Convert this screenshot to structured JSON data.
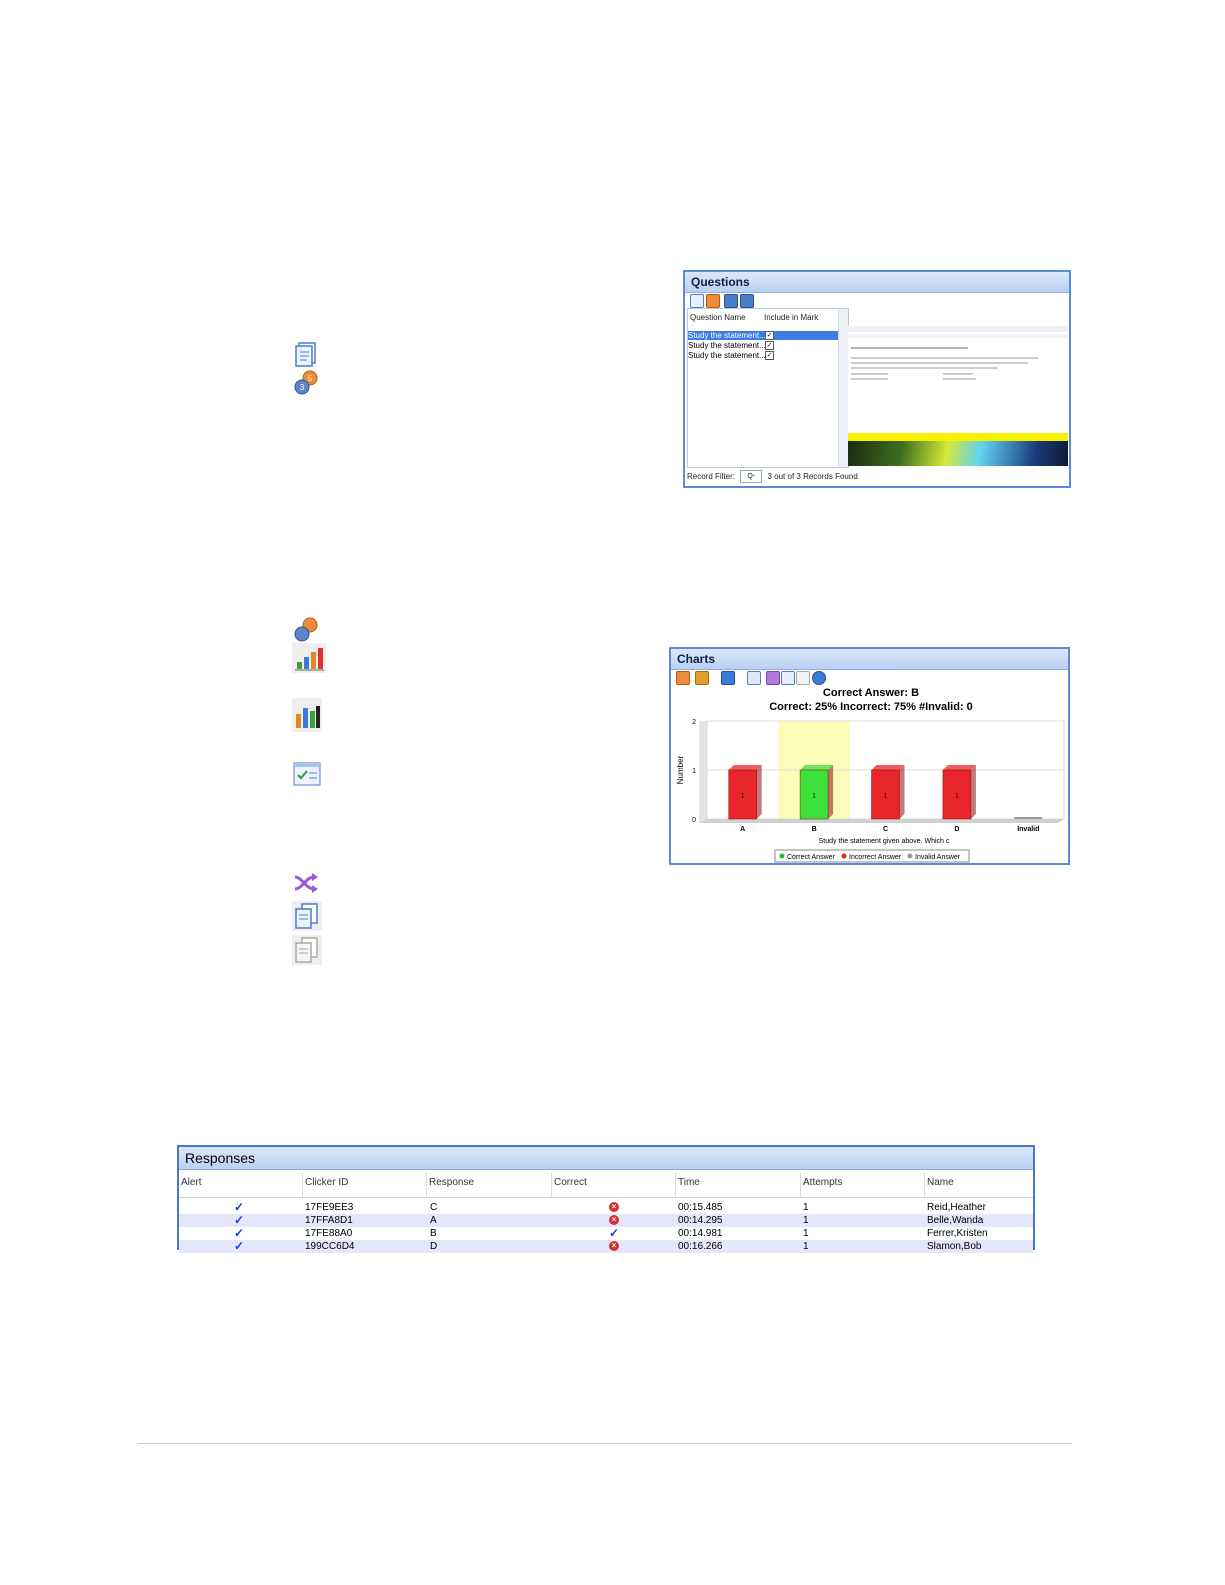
{
  "questions": {
    "title": "Questions",
    "col_name": "Question Name",
    "col_include": "Include in Mark",
    "rows": [
      "Study the statement...",
      "Study the statement...",
      "Study the statement..."
    ],
    "filter_label": "Record Filter:",
    "filter_value": "Q-",
    "records_found": "3 out of 3 Records Found",
    "check_glyph": "✓"
  },
  "charts": {
    "title": "Charts"
  },
  "chart_data": {
    "type": "bar",
    "title": "Correct Answer: B",
    "subtitle": "Correct: 25%  Incorrect: 75%  #Invalid: 0",
    "categories": [
      "A",
      "B",
      "C",
      "D",
      "Invalid"
    ],
    "values": [
      1,
      1,
      1,
      1,
      0
    ],
    "data_labels": [
      "1",
      "1",
      "1",
      "1",
      ""
    ],
    "bar_colors": [
      "#e8262a",
      "#3ee03a",
      "#e8262a",
      "#e8262a",
      "#9a9a9a"
    ],
    "highlight_category": "B",
    "highlight_color": "#fafcb8",
    "xlabel": "Study the statement given above. Which c",
    "ylabel": "Number",
    "ylim": [
      0,
      2
    ],
    "yticks": [
      "0",
      "1",
      "2"
    ],
    "legend": [
      {
        "label": "Correct Answer",
        "color": "#22c022"
      },
      {
        "label": "Incorrect Answer",
        "color": "#e02020"
      },
      {
        "label": "Invalid Answer",
        "color": "#999999"
      }
    ],
    "legend_position": "bottom",
    "grid": true
  },
  "responses": {
    "title": "Responses",
    "columns": [
      "Alert",
      "Clicker ID",
      "Response",
      "Correct",
      "Time",
      "Attempts",
      "Name"
    ],
    "tick_glyph": "✓",
    "x_glyph": "×",
    "rows": [
      {
        "clicker": "17FE9EE3",
        "response": "C",
        "correct": false,
        "time": "00:15.485",
        "attempts": "1",
        "name": "Reid,Heather"
      },
      {
        "clicker": "17FFA8D1",
        "response": "A",
        "correct": false,
        "time": "00:14.295",
        "attempts": "1",
        "name": "Belle,Wanda"
      },
      {
        "clicker": "17FE88A0",
        "response": "B",
        "correct": true,
        "time": "00:14.981",
        "attempts": "1",
        "name": "Ferrer,Kristen"
      },
      {
        "clicker": "199CC6D4",
        "response": "D",
        "correct": false,
        "time": "00:16.266",
        "attempts": "1",
        "name": "Slamon,Bob"
      }
    ]
  }
}
